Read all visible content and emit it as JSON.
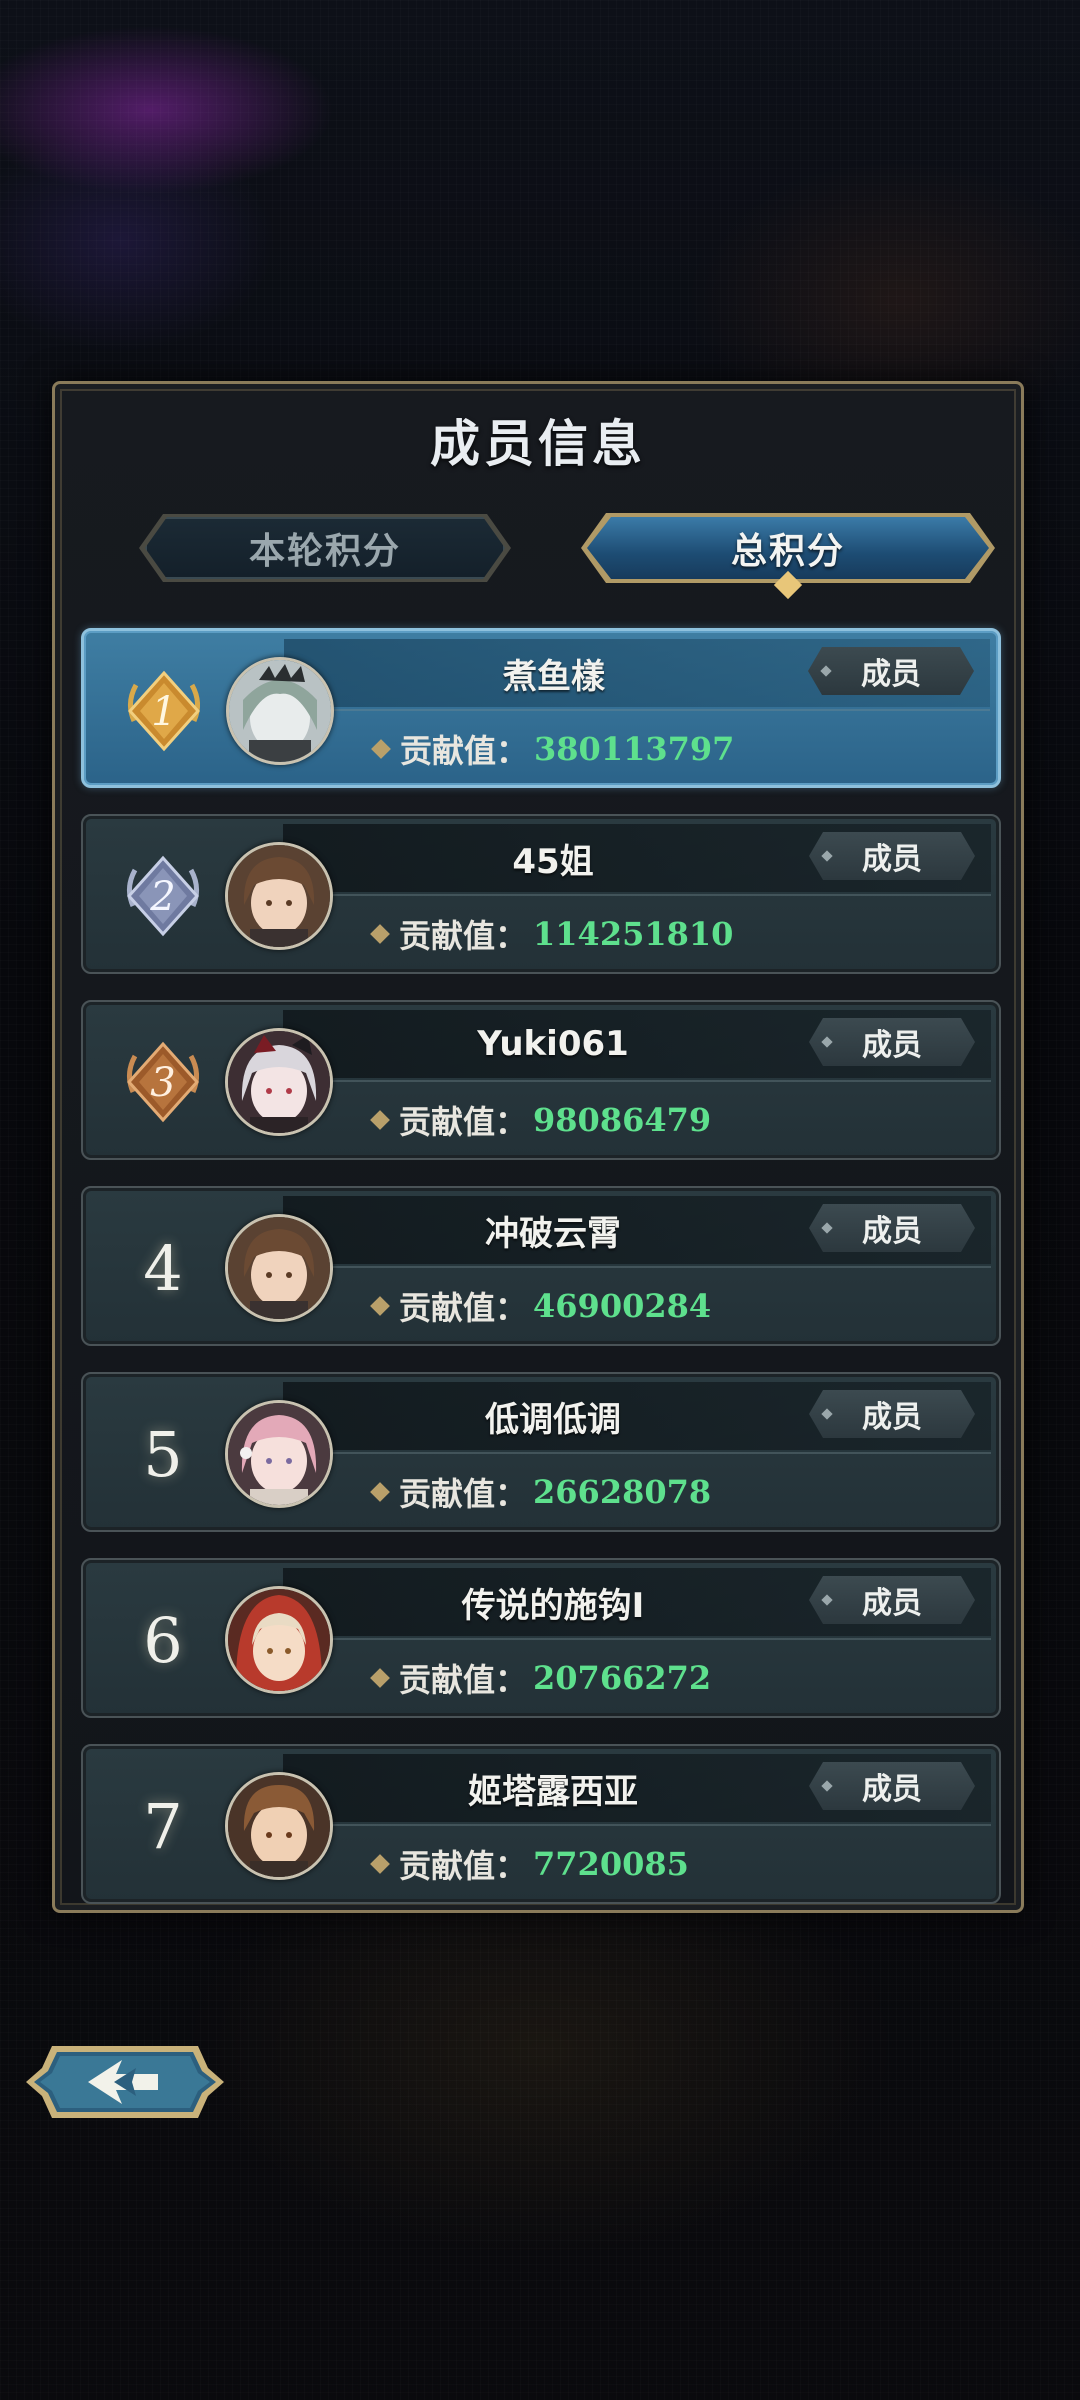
{
  "panel": {
    "title": "成员信息",
    "tabs": [
      {
        "label": "本轮积分",
        "active": false
      },
      {
        "label": "总积分",
        "active": true
      }
    ]
  },
  "members": [
    {
      "rank": "1",
      "name": "煮鱼樣",
      "role": "成员",
      "contribution_label": "贡献值：",
      "contribution": "380113797",
      "highlight": true,
      "badge": "gold"
    },
    {
      "rank": "2",
      "name": "45姐",
      "role": "成员",
      "contribution_label": "贡献值：",
      "contribution": "114251810",
      "badge": "silver"
    },
    {
      "rank": "3",
      "name": "Yuki061",
      "role": "成员",
      "contribution_label": "贡献值：",
      "contribution": "98086479",
      "badge": "bronze"
    },
    {
      "rank": "4",
      "name": "冲破云霄",
      "role": "成员",
      "contribution_label": "贡献值：",
      "contribution": "46900284"
    },
    {
      "rank": "5",
      "name": "低调低调",
      "role": "成员",
      "contribution_label": "贡献值：",
      "contribution": "26628078"
    },
    {
      "rank": "6",
      "name": "传说的施钩I",
      "role": "成员",
      "contribution_label": "贡献值：",
      "contribution": "20766272"
    },
    {
      "rank": "7",
      "name": "姬塔露西亚",
      "role": "成员",
      "contribution_label": "贡献值：",
      "contribution": "7720085"
    }
  ],
  "colors": {
    "contribution_value": "#5ee08d",
    "highlight_row": "#3f7ea3",
    "gold": "#d69a3c",
    "silver": "#8a95b8",
    "bronze": "#b7743d"
  },
  "back_button": {
    "icon": "back-arrow-icon"
  }
}
